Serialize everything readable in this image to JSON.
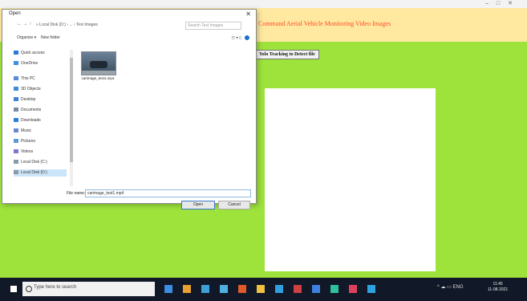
{
  "browser": {
    "title": ""
  },
  "banner": {
    "text": "Command Aerial Vehicle Monitoring Video Images"
  },
  "action_button": {
    "label": "Yolo Tracking to Detect file"
  },
  "dialog": {
    "title": "Open",
    "close": "✕",
    "nav_arrows": "←  →  ↑",
    "address_path": "» Local Disk (D:) › ... › Test Images",
    "search_placeholder": "Search Test Images",
    "organize": "Organize ▾",
    "new_folder": "New folder",
    "view_controls": "☷ ▾  ▯",
    "nav_items": [
      {
        "label": "Quick access",
        "color": "#2a7ad8"
      },
      {
        "label": "OneDrive",
        "color": "#3b8ee0"
      },
      {
        "label": "This PC",
        "color": "#5a8ad8"
      },
      {
        "label": "3D Objects",
        "color": "#3f8ad8"
      },
      {
        "label": "Desktop",
        "color": "#3f7fd8"
      },
      {
        "label": "Documents",
        "color": "#7a8aa0"
      },
      {
        "label": "Downloads",
        "color": "#2f7fd8"
      },
      {
        "label": "Music",
        "color": "#6a8ad0"
      },
      {
        "label": "Pictures",
        "color": "#5b9ad8"
      },
      {
        "label": "Videos",
        "color": "#7a7ad0"
      },
      {
        "label": "Local Disk (C:)",
        "color": "#8a9aa8"
      },
      {
        "label": "Local Disk (D:)",
        "color": "#8a9aa8"
      }
    ],
    "file": {
      "name": "carimage_test1.mp4"
    },
    "filename_label": "File name:",
    "filename_value": "carimage_test1.mp4",
    "open_label": "Open",
    "cancel_label": "Cancel"
  },
  "taskbar": {
    "search_placeholder": "Type here to search",
    "icons": [
      "#3b8ee0",
      "#e8a030",
      "#3f9fd8",
      "#4fb0e0",
      "#e05a2a",
      "#f0c040",
      "#30a0e0",
      "#d04040",
      "#4080e0",
      "#30c0a0",
      "#e04060",
      "#2fa0e0"
    ],
    "tray": "^  ☁  ▭ ENG",
    "time": "11:45",
    "date": "11-08-2021"
  }
}
